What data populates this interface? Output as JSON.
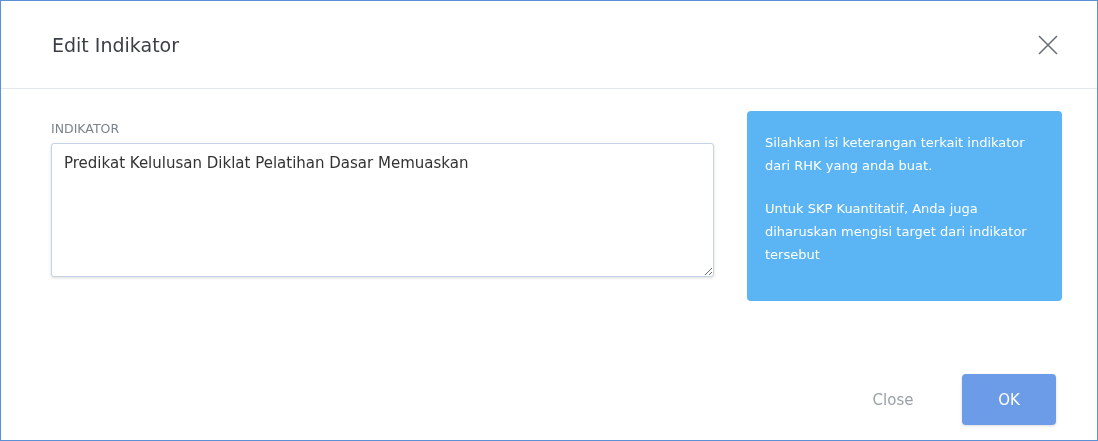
{
  "dialog": {
    "title": "Edit Indikator"
  },
  "field": {
    "label": "INDIKATOR",
    "value": "Predikat Kelulusan Diklat Pelatihan Dasar Memuaskan"
  },
  "info": {
    "paragraphs": [
      "Silahkan isi keterangan terkait indikator dari RHK yang anda buat.",
      "Untuk SKP Kuantitatif, Anda juga diharuskan mengisi target dari indikator tersebut"
    ]
  },
  "buttons": [
    {
      "label": "Close",
      "kind": "secondary"
    },
    {
      "label": "OK",
      "kind": "primary"
    }
  ]
}
